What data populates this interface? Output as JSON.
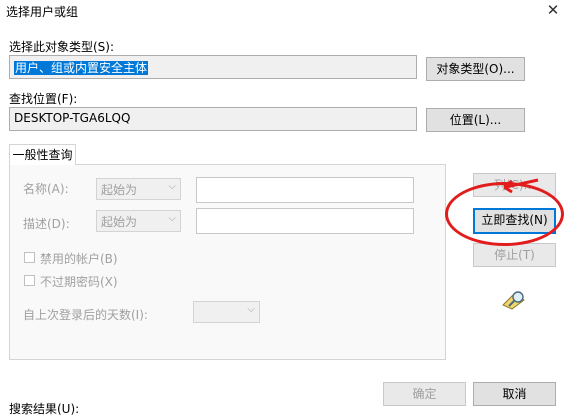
{
  "window": {
    "title": "选择用户或组"
  },
  "object_type": {
    "label": "选择此对象类型(S):",
    "value": "用户、组或内置安全主体",
    "button": "对象类型(O)..."
  },
  "location": {
    "label": "查找位置(F):",
    "value": "DESKTOP-TGA6LQQ",
    "button": "位置(L)..."
  },
  "tab": {
    "label": "一般性查询"
  },
  "query": {
    "name_label": "名称(A):",
    "name_mode": "起始为",
    "desc_label": "描述(D):",
    "desc_mode": "起始为",
    "disabled_accounts": "禁用的帐户(B)",
    "no_expire_password": "不过期密码(X)",
    "days_label": "自上次登录后的天数(I):"
  },
  "actions": {
    "columns": "列(C)...",
    "find_now": "立即查找(N)",
    "stop": "停止(T)"
  },
  "footer": {
    "ok": "确定",
    "cancel": "取消",
    "results_label": "搜索结果(U):"
  },
  "colors": {
    "selection": "#0078d7",
    "annotation": "#e21c1c"
  },
  "icons": {
    "search": "search-people-icon"
  }
}
